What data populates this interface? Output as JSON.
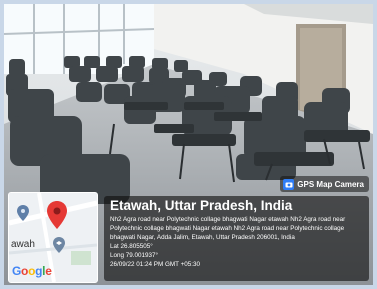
{
  "badge": {
    "label": "GPS Map Camera",
    "icon": "camera-icon"
  },
  "location": {
    "title": "Etawah, Uttar Pradesh, India",
    "address": "Nh2 Agra road near Polytechnic collage bhagwati Nagar etawah Nh2 Agra road near Polytechnic collage bhagwati Nagar etawah Nh2 Agra road near Polytechnic collage bhagwati Nagar, Adda Jalim, Etawah, Uttar Pradesh 206001, India",
    "lat": "Lat 26.805505°",
    "long": "Long 79.001937°",
    "timestamp": "26/09/22 01:24 PM GMT +05:30"
  },
  "map": {
    "label": "awah",
    "google": [
      "G",
      "o",
      "o",
      "g",
      "l",
      "e"
    ],
    "google_colors": [
      "#4285F4",
      "#EA4335",
      "#FBBC05",
      "#4285F4",
      "#34A853",
      "#EA4335"
    ],
    "pin_color": "#e53935"
  }
}
